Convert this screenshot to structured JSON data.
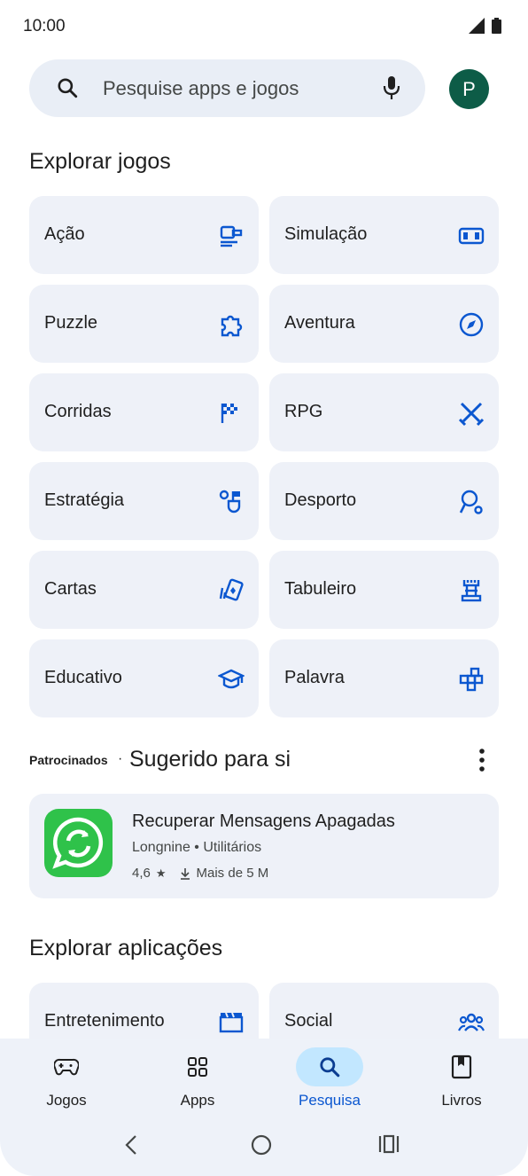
{
  "status": {
    "time": "10:00"
  },
  "search": {
    "placeholder": "Pesquise apps e jogos"
  },
  "profile": {
    "initial": "P",
    "color": "#0d5c47"
  },
  "games_section": {
    "title": "Explorar jogos",
    "categories": [
      {
        "label": "Ação",
        "icon": "action-game-icon"
      },
      {
        "label": "Simulação",
        "icon": "simulation-icon"
      },
      {
        "label": "Puzzle",
        "icon": "puzzle-icon"
      },
      {
        "label": "Aventura",
        "icon": "compass-icon"
      },
      {
        "label": "Corridas",
        "icon": "checkered-flag-icon"
      },
      {
        "label": "RPG",
        "icon": "crossed-swords-icon"
      },
      {
        "label": "Estratégia",
        "icon": "strategy-icon"
      },
      {
        "label": "Desporto",
        "icon": "sports-icon"
      },
      {
        "label": "Cartas",
        "icon": "cards-icon"
      },
      {
        "label": "Tabuleiro",
        "icon": "chess-rook-icon"
      },
      {
        "label": "Educativo",
        "icon": "graduation-cap-icon"
      },
      {
        "label": "Palavra",
        "icon": "word-tiles-icon"
      }
    ]
  },
  "sponsored": {
    "label": "Patrocinados",
    "separator": "·",
    "title": "Sugerido para si",
    "app": {
      "name": "Recuperar Mensagens Apagadas",
      "developer": "Longnine",
      "category": "Utilitários",
      "dev_line": "Longnine • Utilitários",
      "rating": "4,6",
      "downloads": "Mais de 5 M"
    }
  },
  "apps_section": {
    "title": "Explorar aplicações",
    "categories": [
      {
        "label": "Entretenimento",
        "icon": "clapperboard-icon"
      },
      {
        "label": "Social",
        "icon": "group-icon"
      }
    ]
  },
  "bottom_nav": {
    "items": [
      {
        "label": "Jogos",
        "icon": "gamepad-icon",
        "active": false
      },
      {
        "label": "Apps",
        "icon": "apps-grid-icon",
        "active": false
      },
      {
        "label": "Pesquisa",
        "icon": "search-icon",
        "active": true
      },
      {
        "label": "Livros",
        "icon": "bookmark-book-icon",
        "active": false
      }
    ]
  },
  "colors": {
    "accent": "#0b57d0",
    "tile_bg": "#eef1f8",
    "search_bg": "#e9eef6",
    "active_nav": "#c2e7ff"
  }
}
